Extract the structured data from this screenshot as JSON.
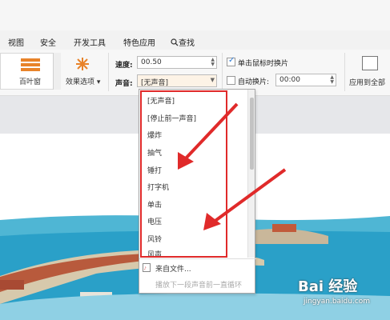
{
  "menu": [
    "视图",
    "安全",
    "开发工具",
    "特色应用",
    "查找"
  ],
  "ribbon": {
    "transition_label": "百叶窗",
    "effect_label": "效果选项",
    "speed_label": "速度:",
    "speed_value": "00.50",
    "sound_label": "声音:",
    "sound_value": "[无声音]",
    "click_advance_label": "单击鼠标时换片",
    "click_advance_checked": true,
    "auto_advance_label": "自动换片:",
    "auto_advance_checked": false,
    "auto_advance_value": "00:00",
    "apply_all_label": "应用到全部"
  },
  "sound_options": [
    "[无声音]",
    "[停止前一声音]",
    "爆炸",
    "抽气",
    "锤打",
    "打字机",
    "单击",
    "电压",
    "风铃",
    "风声"
  ],
  "sound_extra": {
    "from_file": "来自文件...",
    "loop_until_next": "播放下一段声音前一直循环"
  },
  "watermark": {
    "brand": "Bai 经验",
    "url": "jingyan.baidu.com"
  },
  "colors": {
    "highlight_box": "#e02a2a",
    "arrow": "#e02a2a",
    "transition_icon": "#e8832a"
  }
}
